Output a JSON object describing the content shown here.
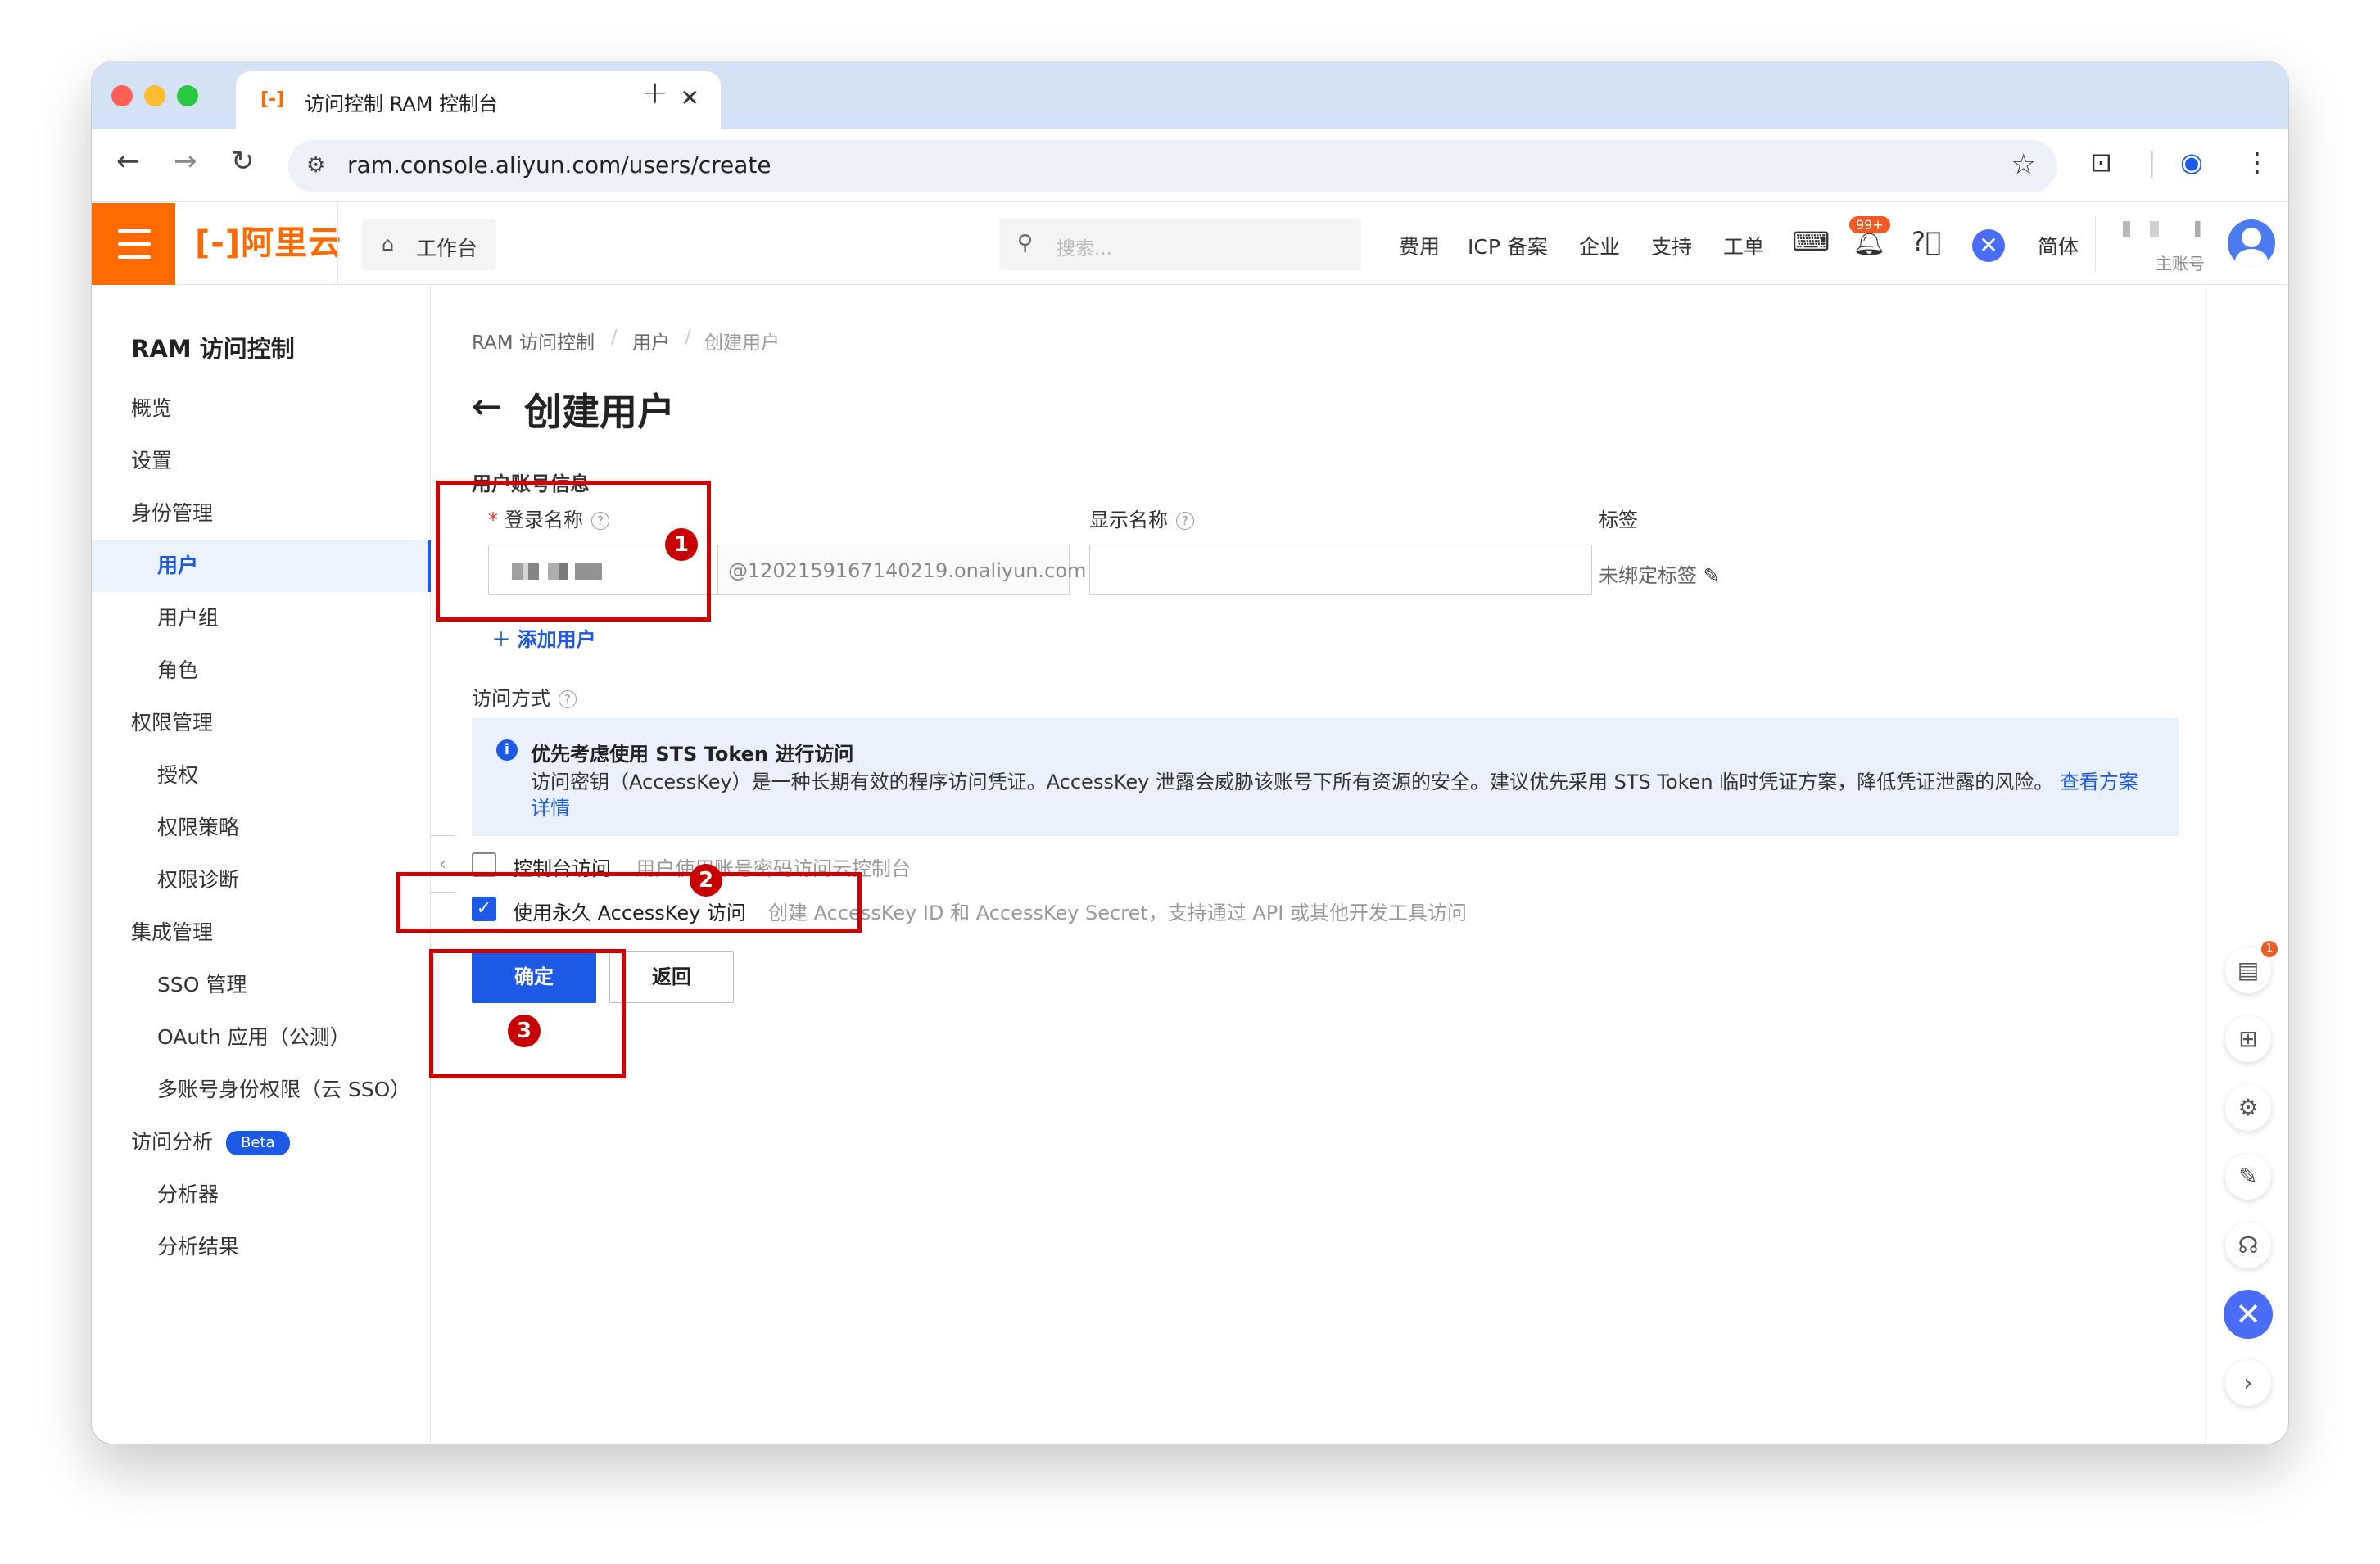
{
  "browser": {
    "tab_title": "访问控制 RAM 控制台",
    "tab_logo": "[-]",
    "tab_close": "✕",
    "new_tab": "+",
    "url": "ram.console.aliyun.com/users/create",
    "icons": [
      "back-icon",
      "forward-icon",
      "reload-icon",
      "site-settings-icon",
      "bookmark-star-icon",
      "page-search-icon",
      "profile-icon",
      "menu-dots-icon"
    ]
  },
  "topbar": {
    "brand": "[-]阿里云",
    "workbench": "工作台",
    "search_placeholder": "搜索...",
    "nav": [
      "费用",
      "ICP 备案",
      "企业",
      "支持",
      "工单"
    ],
    "notif_badge": "99+",
    "lang": "简体",
    "account_sub": "主账号",
    "accent_color": "#ff6a00"
  },
  "sidebar": {
    "title": "RAM 访问控制",
    "items": [
      {
        "label": "概览",
        "level": 0
      },
      {
        "label": "设置",
        "level": 0
      },
      {
        "label": "身份管理",
        "level": 0
      },
      {
        "label": "用户",
        "level": 1,
        "active": true
      },
      {
        "label": "用户组",
        "level": 1
      },
      {
        "label": "角色",
        "level": 1
      },
      {
        "label": "权限管理",
        "level": 0
      },
      {
        "label": "授权",
        "level": 1
      },
      {
        "label": "权限策略",
        "level": 1
      },
      {
        "label": "权限诊断",
        "level": 1
      },
      {
        "label": "集成管理",
        "level": 0
      },
      {
        "label": "SSO 管理",
        "level": 1
      },
      {
        "label": "OAuth 应用（公测）",
        "level": 1
      },
      {
        "label": "多账号身份权限（云 SSO）",
        "level": 1
      },
      {
        "label": "访问分析",
        "level": 0,
        "badge": "Beta"
      },
      {
        "label": "分析器",
        "level": 1
      },
      {
        "label": "分析结果",
        "level": 1
      }
    ]
  },
  "main": {
    "breadcrumb": [
      "RAM 访问控制",
      "用户",
      "创建用户"
    ],
    "title": "创建用户",
    "section_account": "用户账号信息",
    "login_name_label": "登录名称",
    "login_suffix": "@1202159167140219.onaliyun.com",
    "display_name_label": "显示名称",
    "display_name_value": "",
    "tag_label": "标签",
    "tag_value": "未绑定标签",
    "add_user": "添加用户",
    "access_label": "访问方式",
    "alert_title": "优先考虑使用 STS Token 进行访问",
    "alert_body": "访问密钥（AccessKey）是一种长期有效的程序访问凭证。AccessKey 泄露会威胁该账号下所有资源的安全。建议优先采用 STS Token 临时凭证方案，降低凭证泄露的风险。",
    "alert_link1": "查看方案",
    "alert_link2": "详情",
    "console_access_label": "控制台访问",
    "console_access_desc": "用户使用账号密码访问云控制台",
    "console_access_checked": false,
    "ak_access_label": "使用永久 AccessKey 访问",
    "ak_access_desc": "创建 AccessKey ID 和 AccessKey Secret，支持通过 API 或其他开发工具访问",
    "ak_access_checked": true,
    "confirm": "确定",
    "back": "返回",
    "primary_color": "#1c5ae6"
  },
  "annotations": [
    "1",
    "2",
    "3"
  ],
  "rail": {
    "doc_badge": "1"
  }
}
